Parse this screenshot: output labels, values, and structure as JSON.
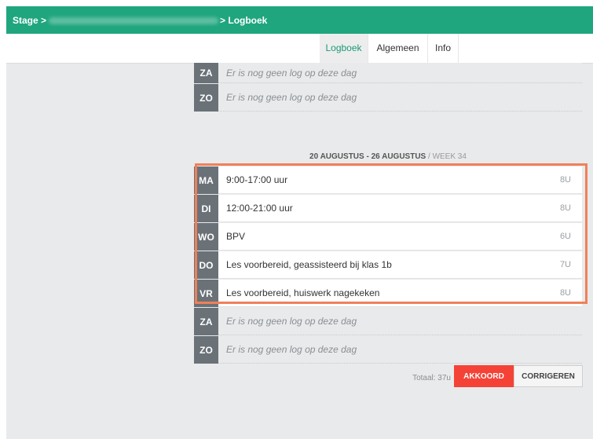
{
  "breadcrumb": {
    "stage": "Stage",
    "separator": ">",
    "current": "Logboek"
  },
  "tabs": [
    {
      "label": "Logboek",
      "active": true
    },
    {
      "label": "Algemeen",
      "active": false
    },
    {
      "label": "Info",
      "active": false
    }
  ],
  "prev_week_rows": [
    {
      "day": "ZA",
      "text": "Er is nog geen log op deze dag"
    },
    {
      "day": "ZO",
      "text": "Er is nog geen log op deze dag"
    }
  ],
  "week": {
    "range": "20 AUGUSTUS - 26 AUGUSTUS",
    "separator": "/",
    "number": "WEEK 34"
  },
  "entries": [
    {
      "day": "MA",
      "text": "9:00-17:00 uur",
      "hours": "8U"
    },
    {
      "day": "DI",
      "text": "12:00-21:00 uur",
      "hours": "8U"
    },
    {
      "day": "WO",
      "text": "BPV",
      "hours": "6U"
    },
    {
      "day": "DO",
      "text": "Les voorbereid, geassisteerd bij klas 1b",
      "hours": "7U"
    },
    {
      "day": "VR",
      "text": "Les voorbereid, huiswerk nagekeken",
      "hours": "8U"
    }
  ],
  "empty_rows": [
    {
      "day": "ZA",
      "text": "Er is nog geen log op deze dag"
    },
    {
      "day": "ZO",
      "text": "Er is nog geen log op deze dag"
    }
  ],
  "footer": {
    "total": "Totaal: 37u",
    "approve_label": "AKKOORD",
    "correct_label": "CORRIGEREN"
  },
  "colors": {
    "topbar": "#1fa67e",
    "day_badge": "#6a7278",
    "highlight": "#f0805a",
    "approve": "#f44336"
  }
}
